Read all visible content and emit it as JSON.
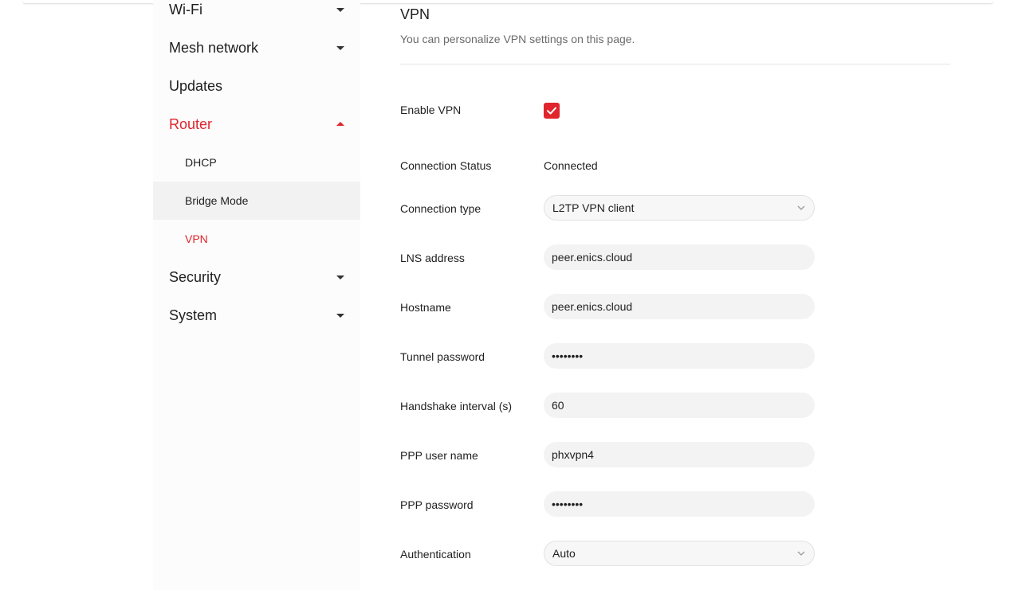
{
  "sidebar": {
    "items": [
      {
        "label": "Wi-Fi",
        "level": "top",
        "caret": "down"
      },
      {
        "label": "Mesh network",
        "level": "top",
        "caret": "down"
      },
      {
        "label": "Updates",
        "level": "top",
        "caret": ""
      },
      {
        "label": "Router",
        "level": "top",
        "caret": "up",
        "state": "active-parent"
      },
      {
        "label": "DHCP",
        "level": "sub"
      },
      {
        "label": "Bridge Mode",
        "level": "sub",
        "state": "hovered"
      },
      {
        "label": "VPN",
        "level": "sub",
        "state": "active-sub"
      },
      {
        "label": "Security",
        "level": "top",
        "caret": "down"
      },
      {
        "label": "System",
        "level": "top",
        "caret": "down"
      }
    ]
  },
  "main": {
    "title": "VPN",
    "description": "You can personalize VPN settings on this page.",
    "enable_vpn": {
      "label": "Enable VPN",
      "checked": true
    },
    "connection_status": {
      "label": "Connection Status",
      "value": "Connected"
    },
    "connection_type": {
      "label": "Connection type",
      "value": "L2TP VPN client"
    },
    "lns_address": {
      "label": "LNS address",
      "value": "peer.enics.cloud"
    },
    "hostname": {
      "label": "Hostname",
      "value": "peer.enics.cloud"
    },
    "tunnel_password": {
      "label": "Tunnel password",
      "value": "••••••••"
    },
    "handshake_interval": {
      "label": "Handshake interval (s)",
      "value": "60"
    },
    "ppp_user_name": {
      "label": "PPP user name",
      "value": "phxvpn4"
    },
    "ppp_password": {
      "label": "PPP password",
      "value": "••••••••"
    },
    "authentication": {
      "label": "Authentication",
      "value": "Auto"
    }
  },
  "colors": {
    "accent": "#e0252c",
    "field_bg": "#f3f3f3",
    "sidebar_bg": "#fcfcfc",
    "hover_bg": "#f2f2f2"
  }
}
